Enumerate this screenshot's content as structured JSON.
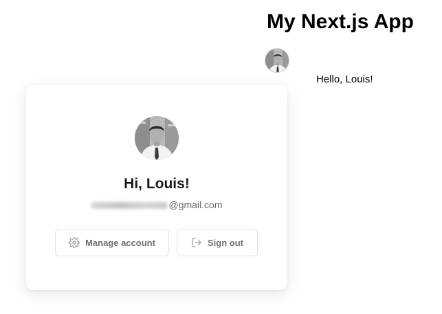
{
  "header": {
    "title": "My Next.js App",
    "greeting": "Hello, Louis!",
    "avatar_icon": "user-photo"
  },
  "user_card": {
    "greeting": "Hi, Louis!",
    "email_domain": "@gmail.com",
    "email_local_part_obscured": true,
    "avatar_icon": "user-photo",
    "actions": {
      "manage_account_label": "Manage account",
      "manage_account_icon": "gear-icon",
      "sign_out_label": "Sign out",
      "sign_out_icon": "sign-out-icon"
    }
  },
  "colors": {
    "text_primary": "#000000",
    "text_muted": "#6b6b6b",
    "button_border": "#e2e2e2"
  }
}
